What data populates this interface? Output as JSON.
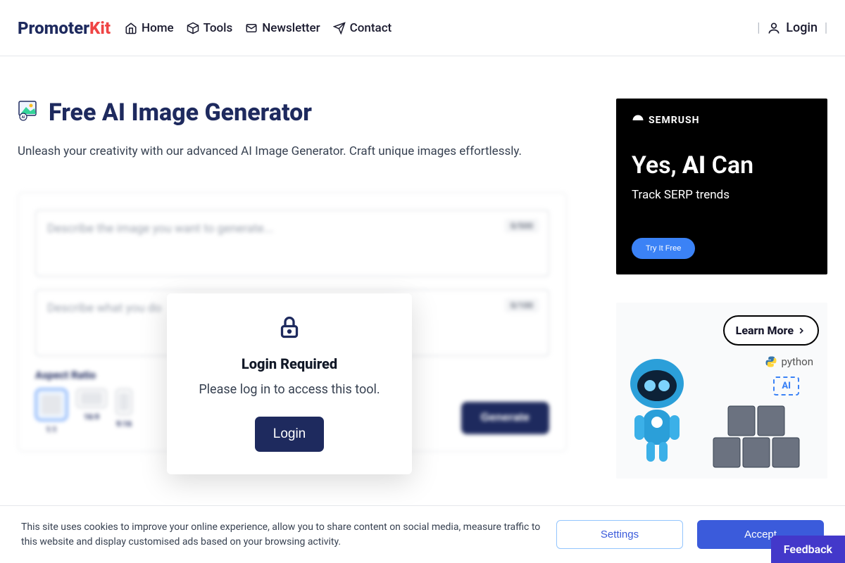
{
  "brand": {
    "part1": "Promoter",
    "part2": "Kit"
  },
  "nav": {
    "home": "Home",
    "tools": "Tools",
    "newsletter": "Newsletter",
    "contact": "Contact"
  },
  "login": "Login",
  "page": {
    "title": "Free AI Image Generator",
    "subtitle": "Unleash your creativity with our advanced AI Image Generator. Craft unique images effortlessly."
  },
  "form": {
    "prompt_placeholder": "Describe the image you want to generate...",
    "prompt_counter": "0/500",
    "negative_placeholder": "Describe what you do",
    "negative_counter": "0/100",
    "aspect_label": "Aspect Ratio",
    "ratios": {
      "r11": "1:1",
      "r169": "16:9",
      "r916": "9:16"
    },
    "generate": "Generate"
  },
  "modal": {
    "title": "Login Required",
    "text": "Please log in to access this tool.",
    "button": "Login"
  },
  "ads": {
    "semrush": {
      "logo": "SEMRUSH",
      "headline_pre": "Yes, ",
      "headline_bold": "AI",
      "headline_post": " Can",
      "sub": "Track SERP trends",
      "cta": "Try It Free"
    },
    "python": {
      "cta": "Learn More",
      "python": "python",
      "ai": "AI"
    }
  },
  "cookie": {
    "text": "This site uses cookies to improve your online experience, allow you to share content on social media, measure traffic to this website and display customised ads based on your browsing activity.",
    "settings": "Settings",
    "accept": "Accept"
  },
  "feedback": "Feedback"
}
